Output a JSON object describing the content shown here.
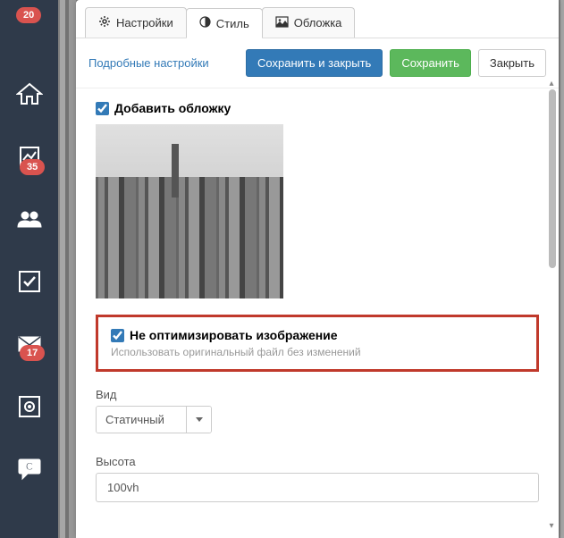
{
  "sidebar": {
    "badges": {
      "top": "20",
      "charts": "35",
      "mail": "17"
    }
  },
  "tabs": [
    {
      "label": "Настройки"
    },
    {
      "label": "Стиль"
    },
    {
      "label": "Обложка"
    }
  ],
  "toolbar": {
    "detailed_link": "Подробные настройки",
    "save_close": "Сохранить и закрыть",
    "save": "Сохранить",
    "close": "Закрыть"
  },
  "content": {
    "add_cover_label": "Добавить обложку",
    "no_optimize_label": "Не оптимизировать изображение",
    "no_optimize_help": "Использовать оригинальный файл без изменений",
    "view_label": "Вид",
    "view_value": "Статичный",
    "height_label": "Высота",
    "height_value": "100vh"
  }
}
